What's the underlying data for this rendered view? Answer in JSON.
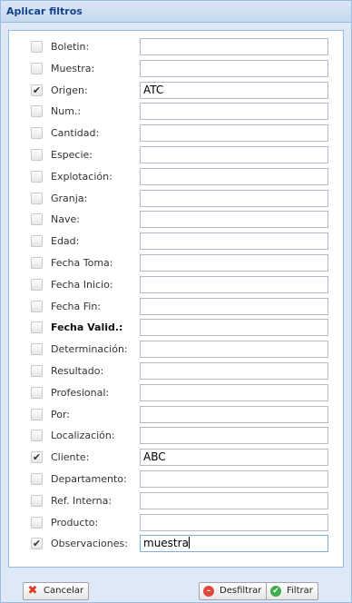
{
  "dialog": {
    "title": "Aplicar filtros"
  },
  "filters": [
    {
      "label": "Boletin:",
      "checked": false,
      "value": ""
    },
    {
      "label": "Muestra:",
      "checked": false,
      "value": ""
    },
    {
      "label": "Origen:",
      "checked": true,
      "value": "ATC"
    },
    {
      "label": "Num.:",
      "checked": false,
      "value": ""
    },
    {
      "label": "Cantidad:",
      "checked": false,
      "value": ""
    },
    {
      "label": "Especie:",
      "checked": false,
      "value": ""
    },
    {
      "label": "Explotación:",
      "checked": false,
      "value": ""
    },
    {
      "label": "Granja:",
      "checked": false,
      "value": ""
    },
    {
      "label": "Nave:",
      "checked": false,
      "value": ""
    },
    {
      "label": "Edad:",
      "checked": false,
      "value": ""
    },
    {
      "label": "Fecha Toma:",
      "checked": false,
      "value": ""
    },
    {
      "label": "Fecha Inicio:",
      "checked": false,
      "value": ""
    },
    {
      "label": "Fecha Fin:",
      "checked": false,
      "value": ""
    },
    {
      "label": "Fecha Valid.:",
      "checked": false,
      "value": "",
      "bold": true
    },
    {
      "label": "Determinación:",
      "checked": false,
      "value": ""
    },
    {
      "label": "Resultado:",
      "checked": false,
      "value": ""
    },
    {
      "label": "Profesional:",
      "checked": false,
      "value": ""
    },
    {
      "label": "Por:",
      "checked": false,
      "value": ""
    },
    {
      "label": "Localización:",
      "checked": false,
      "value": ""
    },
    {
      "label": "Cliente:",
      "checked": true,
      "value": "ABC"
    },
    {
      "label": "Departamento:",
      "checked": false,
      "value": ""
    },
    {
      "label": "Ref. Interna:",
      "checked": false,
      "value": ""
    },
    {
      "label": "Producto:",
      "checked": false,
      "value": ""
    },
    {
      "label": "Observaciones:",
      "checked": true,
      "value": "muestra",
      "focused": true
    }
  ],
  "buttons": {
    "cancel_label": "Cancelar",
    "unfilter_label": "Desfiltrar",
    "filter_label": "Filtrar"
  },
  "icons": {
    "check_mark": "✔",
    "cancel": "✖",
    "unfilter": "–",
    "filter": "✔"
  }
}
